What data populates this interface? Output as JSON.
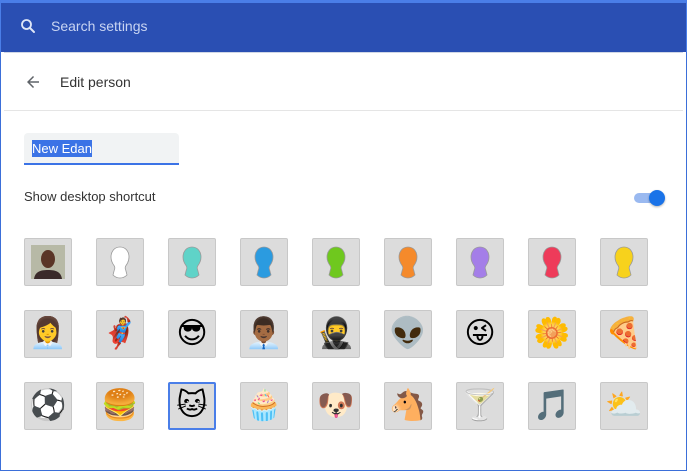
{
  "search": {
    "placeholder": "Search settings",
    "icon": "search-icon"
  },
  "header": {
    "title": "Edit person",
    "back_icon": "arrow-back-icon"
  },
  "name_field": {
    "value": "New Edan"
  },
  "shortcut": {
    "label": "Show desktop shortcut",
    "enabled": true
  },
  "avatars": [
    {
      "name": "photo-avatar",
      "kind": "photo"
    },
    {
      "name": "white-head-avatar",
      "kind": "head",
      "color": "#ffffff"
    },
    {
      "name": "teal-head-avatar",
      "kind": "head",
      "color": "#5fd3c8"
    },
    {
      "name": "blue-head-avatar",
      "kind": "head",
      "color": "#2b9be0"
    },
    {
      "name": "green-head-avatar",
      "kind": "head",
      "color": "#6fc81e"
    },
    {
      "name": "orange-head-avatar",
      "kind": "head",
      "color": "#f58a2b"
    },
    {
      "name": "purple-head-avatar",
      "kind": "head",
      "color": "#a47ee8"
    },
    {
      "name": "red-head-avatar",
      "kind": "head",
      "color": "#ee3b5a"
    },
    {
      "name": "yellow-head-avatar",
      "kind": "head",
      "color": "#f7d21c"
    },
    {
      "name": "businesswoman-avatar",
      "kind": "emoji",
      "glyph": "👩‍💼"
    },
    {
      "name": "superhero-avatar",
      "kind": "emoji",
      "glyph": "🦸"
    },
    {
      "name": "sunglasses-woman-avatar",
      "kind": "emoji",
      "glyph": "😎"
    },
    {
      "name": "businessman-avatar",
      "kind": "emoji",
      "glyph": "👨🏾‍💼"
    },
    {
      "name": "ninja-avatar",
      "kind": "emoji",
      "glyph": "🥷"
    },
    {
      "name": "alien-avatar",
      "kind": "emoji",
      "glyph": "👽"
    },
    {
      "name": "smiley-avatar",
      "kind": "emoji",
      "glyph": "😜"
    },
    {
      "name": "flower-avatar",
      "kind": "emoji",
      "glyph": "🌼"
    },
    {
      "name": "pizza-avatar",
      "kind": "emoji",
      "glyph": "🍕"
    },
    {
      "name": "soccer-ball-avatar",
      "kind": "emoji",
      "glyph": "⚽"
    },
    {
      "name": "burger-avatar",
      "kind": "emoji",
      "glyph": "🍔"
    },
    {
      "name": "cat-avatar",
      "kind": "emoji",
      "glyph": "🐱",
      "selected": true
    },
    {
      "name": "cupcake-avatar",
      "kind": "emoji",
      "glyph": "🧁"
    },
    {
      "name": "dog-avatar",
      "kind": "emoji",
      "glyph": "🐶"
    },
    {
      "name": "horse-avatar",
      "kind": "emoji",
      "glyph": "🐴"
    },
    {
      "name": "cocktail-avatar",
      "kind": "emoji",
      "glyph": "🍸"
    },
    {
      "name": "music-note-avatar",
      "kind": "emoji",
      "glyph": "🎵"
    },
    {
      "name": "sun-cloud-avatar",
      "kind": "emoji",
      "glyph": "⛅"
    }
  ]
}
